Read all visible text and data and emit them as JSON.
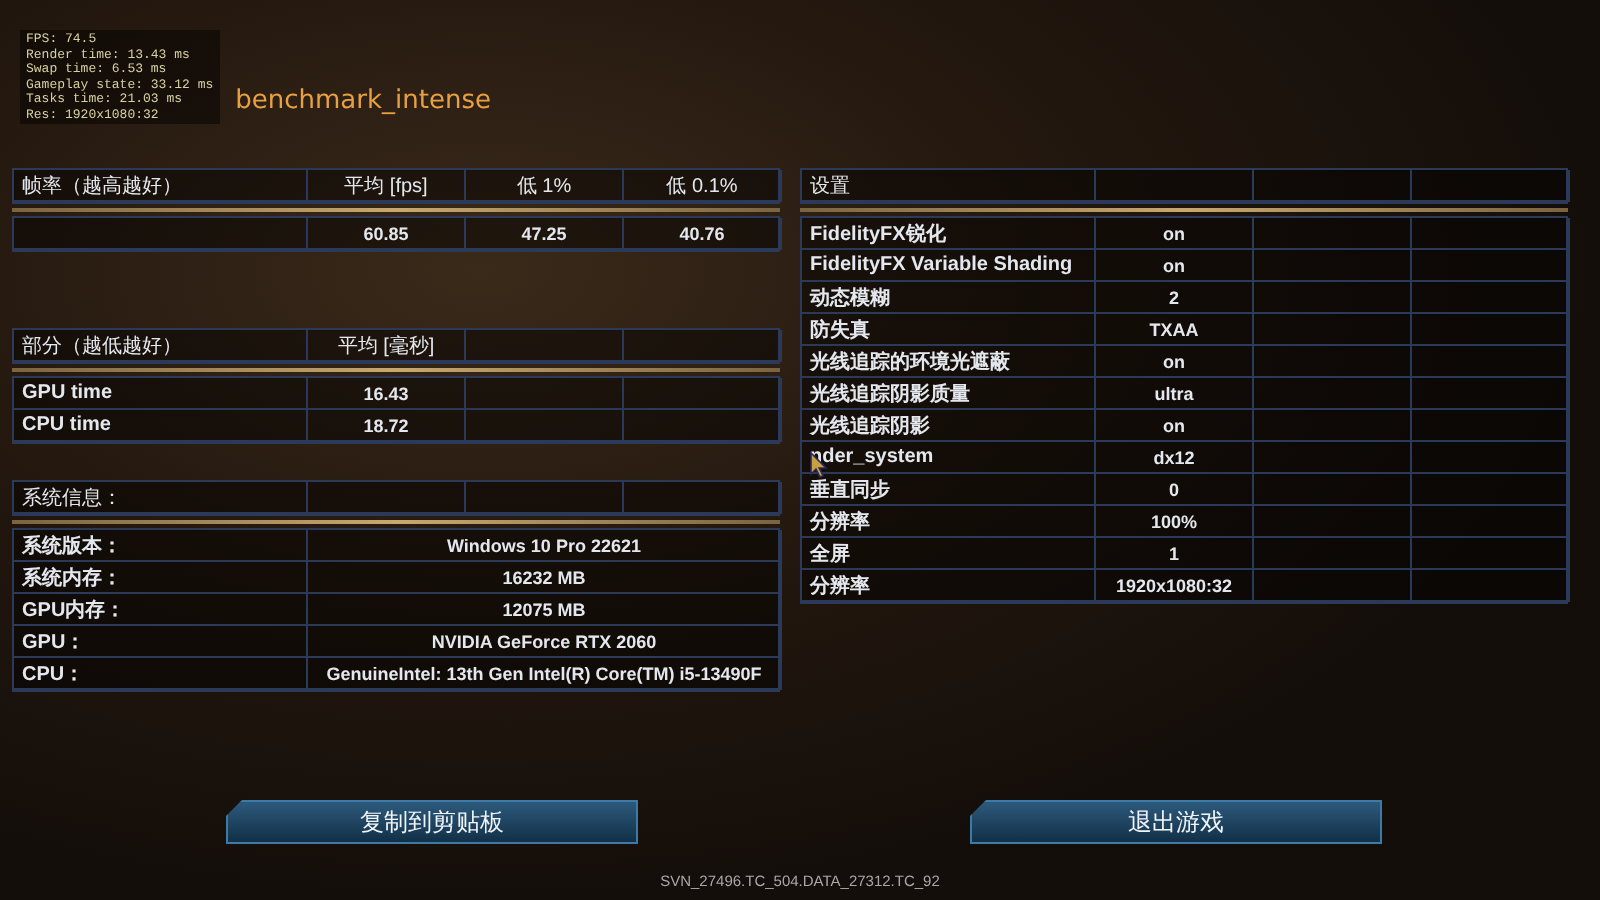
{
  "debug_overlay": [
    "FPS: 74.5",
    "Render time: 13.43 ms",
    "Swap time: 6.53 ms",
    "Gameplay state: 33.12 ms",
    "Tasks time: 21.03 ms",
    "Res: 1920x1080:32"
  ],
  "title": "benchmark_intense",
  "fps_table": {
    "label_header": "帧率（越高越好）",
    "columns": [
      "平均 [fps]",
      "低 1%",
      "低 0.1%"
    ],
    "rows": [
      {
        "cells": [
          "60.85",
          "47.25",
          "40.76"
        ]
      }
    ]
  },
  "parts_table": {
    "columns": [
      "部分（越低越好）",
      "平均 [毫秒]"
    ],
    "rows": [
      {
        "label": "GPU time",
        "value": "16.43"
      },
      {
        "label": "CPU time",
        "value": "18.72"
      }
    ]
  },
  "system_info": {
    "header": "系统信息：",
    "rows": [
      {
        "label": "系统版本：",
        "value": "Windows 10 Pro 22621"
      },
      {
        "label": "系统内存：",
        "value": "16232 MB"
      },
      {
        "label": "GPU内存：",
        "value": "12075 MB"
      },
      {
        "label": "GPU：",
        "value": "NVIDIA GeForce RTX 2060"
      },
      {
        "label": "CPU：",
        "value": "GenuineIntel: 13th Gen Intel(R) Core(TM) i5-13490F"
      }
    ]
  },
  "settings": {
    "header": "设置",
    "rows": [
      {
        "label": "FidelityFX锐化",
        "value": "on"
      },
      {
        "label": "FidelityFX Variable Shading",
        "value": "on"
      },
      {
        "label": "动态模糊",
        "value": "2"
      },
      {
        "label": "防失真",
        "value": "TXAA"
      },
      {
        "label": "光线追踪的环境光遮蔽",
        "value": "on"
      },
      {
        "label": "光线追踪阴影质量",
        "value": "ultra"
      },
      {
        "label": "光线追踪阴影",
        "value": "on"
      },
      {
        "label": "nder_system",
        "value": "dx12"
      },
      {
        "label": "垂直同步",
        "value": "0"
      },
      {
        "label": "分辨率",
        "value": "100%"
      },
      {
        "label": "全屏",
        "value": "1"
      },
      {
        "label": "分辨率",
        "value": "1920x1080:32"
      }
    ]
  },
  "buttons": [
    "复制到剪贴板",
    "退出游戏"
  ],
  "build": "SVN_27496.TC_504.DATA_27312.TC_92"
}
